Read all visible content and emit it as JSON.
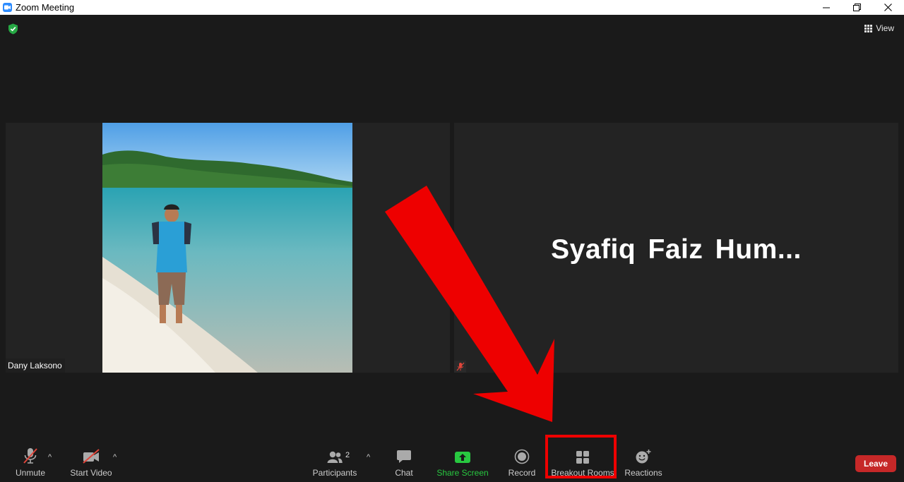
{
  "window": {
    "title": "Zoom Meeting",
    "controls": [
      "minimize",
      "restore",
      "close"
    ]
  },
  "meeting": {
    "view_label": "View",
    "participants": [
      {
        "name": "Dany Laksono",
        "video": true
      },
      {
        "name": "Syafiq  Faiz  Hum...",
        "video": false,
        "muted": true
      }
    ]
  },
  "toolbar": {
    "unmute": "Unmute",
    "start_video": "Start Video",
    "participants": "Participants",
    "participants_count": "2",
    "chat": "Chat",
    "share_screen": "Share Screen",
    "record": "Record",
    "breakout_rooms": "Breakout Rooms",
    "reactions": "Reactions",
    "leave": "Leave"
  },
  "colors": {
    "accent": "#2d8cff",
    "share_screen": "#28c840",
    "leave": "#c62828",
    "annotation": "#ee0000"
  }
}
